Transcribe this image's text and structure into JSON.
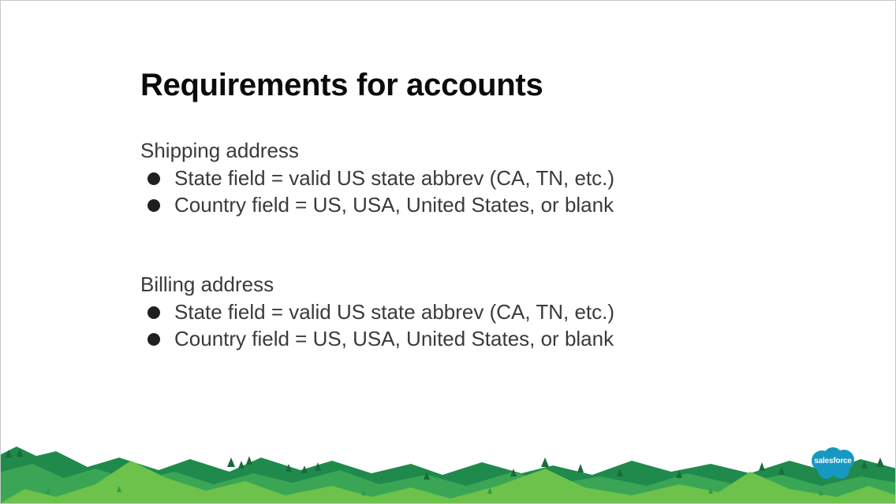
{
  "slide": {
    "title": "Requirements for accounts",
    "sections": [
      {
        "heading": "Shipping address",
        "bullets": [
          "State field = valid US state abbrev (CA, TN, etc.)",
          "Country field = US, USA, United States, or blank"
        ]
      },
      {
        "heading": "Billing address",
        "bullets": [
          "State field = valid US state abbrev (CA, TN, etc.)",
          "Country field = US, USA, United States, or blank"
        ]
      }
    ]
  },
  "footer": {
    "logo_text": "salesforce",
    "logo_icon": "salesforce-cloud-icon",
    "scenery_icon": "mountains-trees-icon",
    "colors": {
      "logo_blue": "#1798c1",
      "mountain_dark": "#1f8a4c",
      "mountain_mid": "#3aa655",
      "mountain_light": "#6cc24a"
    }
  }
}
